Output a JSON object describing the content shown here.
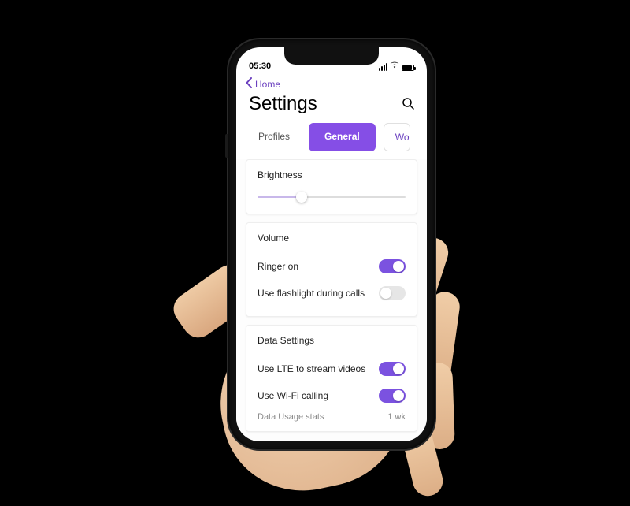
{
  "status": {
    "time": "05:30"
  },
  "nav": {
    "back_label": "Home"
  },
  "header": {
    "title": "Settings"
  },
  "tabs": {
    "items": [
      {
        "label": "Profiles",
        "active": false
      },
      {
        "label": "General",
        "active": true
      },
      {
        "label": "Workspace",
        "active": false,
        "partial": true
      }
    ]
  },
  "brightness": {
    "title": "Brightness",
    "value_pct": 28
  },
  "volume": {
    "title": "Volume",
    "rows": [
      {
        "label": "Ringer on",
        "on": true
      },
      {
        "label": "Use flashlight during calls",
        "on": false
      }
    ]
  },
  "data_settings": {
    "title": "Data Settings",
    "rows": [
      {
        "label": "Use LTE to stream videos",
        "on": true
      },
      {
        "label": "Use Wi-Fi calling",
        "on": true
      }
    ],
    "usage": {
      "label": "Data Usage stats",
      "value": "1 wk"
    }
  },
  "colors": {
    "accent": "#854ee6"
  }
}
